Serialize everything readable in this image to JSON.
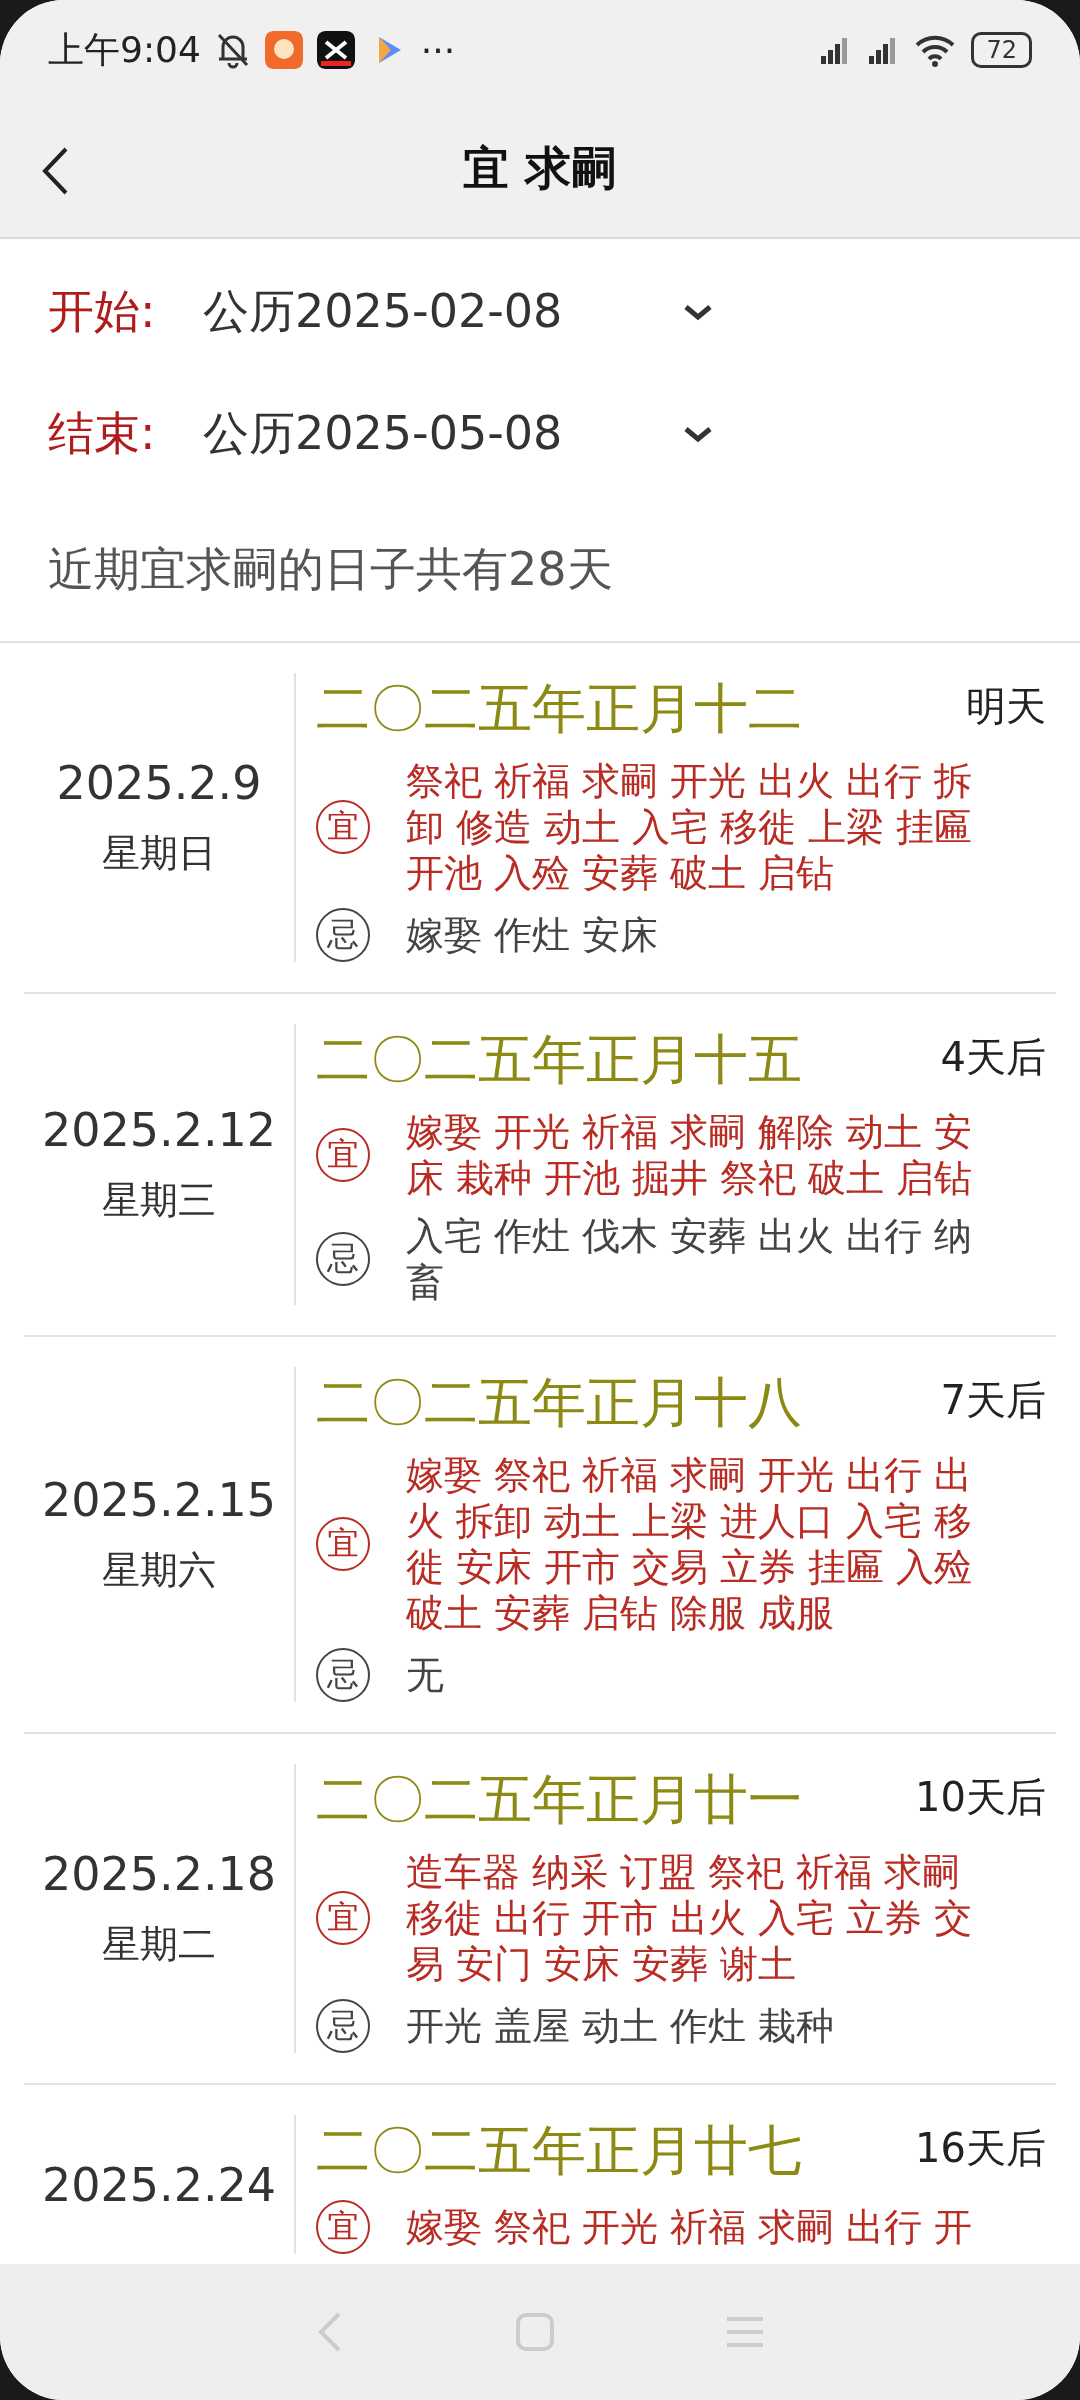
{
  "status_bar": {
    "time": "上午9:04",
    "more": "···",
    "battery": "72"
  },
  "header": {
    "title": "宜 求嗣"
  },
  "range": [
    {
      "label": "开始:",
      "value": "公历2025-02-08"
    },
    {
      "label": "结束:",
      "value": "公历2025-05-08"
    }
  ],
  "summary": "近期宜求嗣的日子共有28天",
  "days": [
    {
      "date": "2025.2.9",
      "weekday": "星期日",
      "lunar": "二〇二五年正月十二",
      "relative": "明天",
      "yi_mark": "宜",
      "yi": "祭祀 祈福 求嗣 开光 出火 出行 拆卸 修造 动土 入宅 移徙 上梁 挂匾开池 入殓 安葬 破土 启钻",
      "ji_mark": "忌",
      "ji": "嫁娶 作灶 安床"
    },
    {
      "date": "2025.2.12",
      "weekday": "星期三",
      "lunar": "二〇二五年正月十五",
      "relative": "4天后",
      "yi_mark": "宜",
      "yi": "嫁娶 开光 祈福 求嗣 解除 动土 安床 栽种 开池 掘井 祭祀 破土 启钻",
      "ji_mark": "忌",
      "ji": "入宅 作灶 伐木 安葬 出火 出行 纳畜"
    },
    {
      "date": "2025.2.15",
      "weekday": "星期六",
      "lunar": "二〇二五年正月十八",
      "relative": "7天后",
      "yi_mark": "宜",
      "yi": "嫁娶 祭祀 祈福 求嗣 开光 出行 出火 拆卸 动土 上梁 进人口 入宅 移徙 安床 开市 交易 立券 挂匾 入殓破土 安葬 启钻 除服 成服",
      "ji_mark": "忌",
      "ji": "无"
    },
    {
      "date": "2025.2.18",
      "weekday": "星期二",
      "lunar": "二〇二五年正月廿一",
      "relative": "10天后",
      "yi_mark": "宜",
      "yi": "造车器 纳采 订盟 祭祀 祈福 求嗣移徙 出行 开市 出火 入宅 立券 交易 安门 安床 安葬 谢土",
      "ji_mark": "忌",
      "ji": "开光 盖屋 动土 作灶 栽种"
    },
    {
      "date": "2025.2.24",
      "lunar": "二〇二五年正月廿七",
      "relative": "16天后",
      "yi_mark": "宜",
      "yi": "嫁娶 祭祀 开光 祈福 求嗣 出行 开"
    }
  ]
}
